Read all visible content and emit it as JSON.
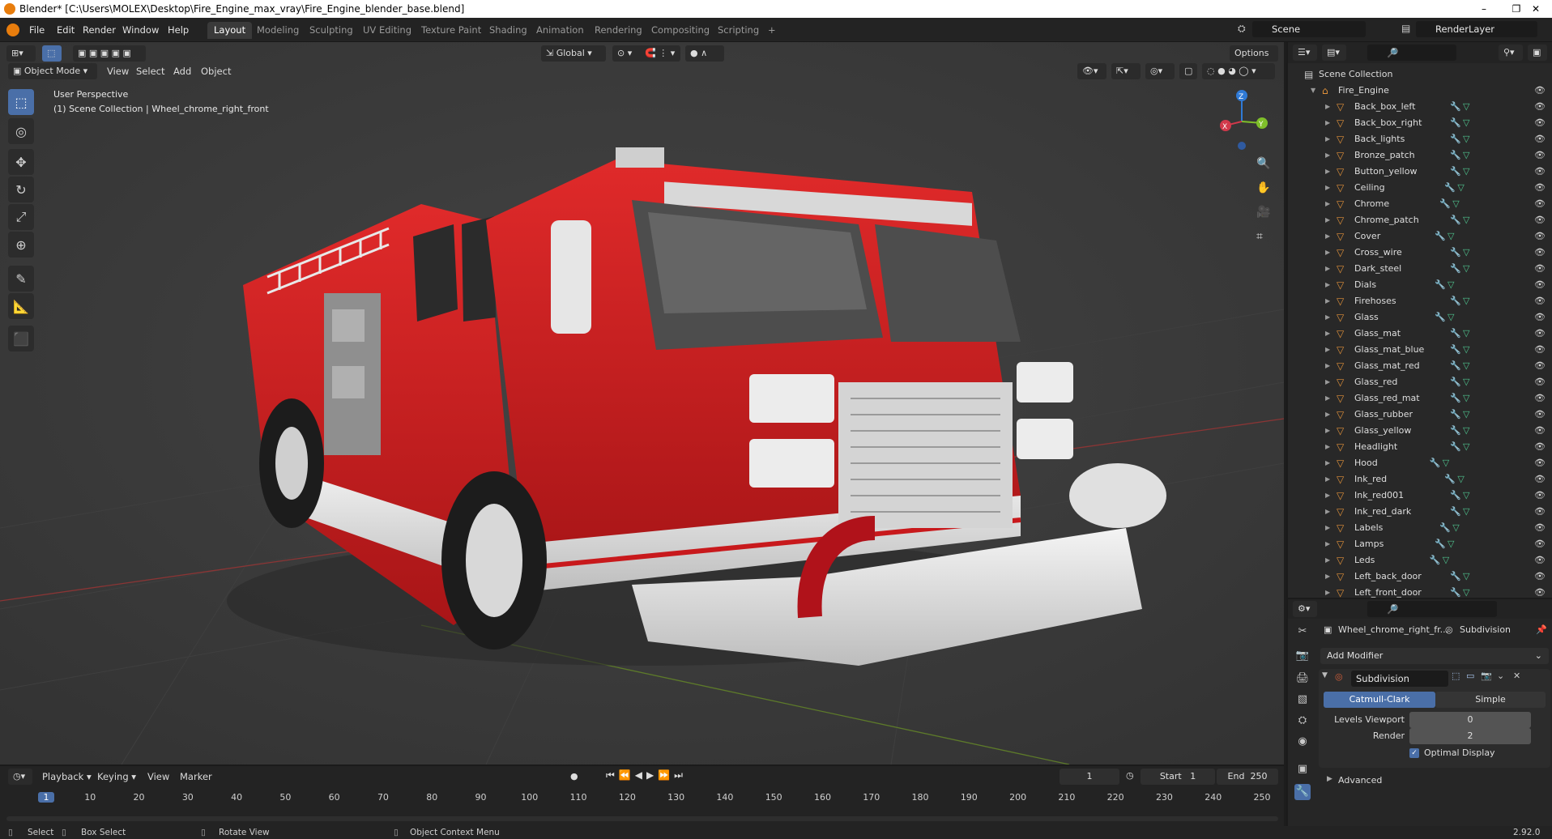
{
  "window": {
    "title": "Blender* [C:\\Users\\MOLEX\\Desktop\\Fire_Engine_max_vray\\Fire_Engine_blender_base.blend]",
    "minimize": "–",
    "maximize": "❐",
    "close": "✕"
  },
  "menu": [
    "File",
    "Edit",
    "Render",
    "Window",
    "Help"
  ],
  "workspaces": [
    "Layout",
    "Modeling",
    "Sculpting",
    "UV Editing",
    "Texture Paint",
    "Shading",
    "Animation",
    "Rendering",
    "Compositing",
    "Scripting"
  ],
  "add_workspace": "+",
  "scene": {
    "name": "Scene",
    "render_layer": "RenderLayer"
  },
  "viewport_header": {
    "mode": "Object Mode",
    "menus": [
      "View",
      "Select",
      "Add",
      "Object"
    ],
    "transform": "Global",
    "options": "Options"
  },
  "overlay_text": {
    "perspective": "User Perspective",
    "collection": "(1) Scene Collection | Wheel_chrome_right_front"
  },
  "gizmo": {
    "z": "Z",
    "y": "Y",
    "x": "X"
  },
  "outliner": {
    "root": "Scene Collection",
    "collection": "Fire_Engine",
    "items": [
      "Back_box_left",
      "Back_box_right",
      "Back_lights",
      "Bronze_patch",
      "Button_yellow",
      "Ceiling",
      "Chrome",
      "Chrome_patch",
      "Cover",
      "Cross_wire",
      "Dark_steel",
      "Dials",
      "Firehoses",
      "Glass",
      "Glass_mat",
      "Glass_mat_blue",
      "Glass_mat_red",
      "Glass_red",
      "Glass_red_mat",
      "Glass_rubber",
      "Glass_yellow",
      "Headlight",
      "Hood",
      "Ink_red",
      "Ink_red001",
      "Ink_red_dark",
      "Labels",
      "Lamps",
      "Leds",
      "Left_back_door",
      "Left_front_door"
    ]
  },
  "properties": {
    "object": "Wheel_chrome_right_fr...",
    "modifier_name_top": "Subdivision",
    "add_modifier": "Add Modifier",
    "modifier": {
      "name": "Subdivision",
      "mode_a": "Catmull-Clark",
      "mode_b": "Simple",
      "levels_viewport_label": "Levels Viewport",
      "levels_viewport": "0",
      "render_label": "Render",
      "render": "2",
      "optimal_display": "Optimal Display",
      "advanced": "Advanced"
    }
  },
  "timeline": {
    "menus": [
      "Playback",
      "Keying",
      "View",
      "Marker"
    ],
    "current_frame": "1",
    "start_label": "Start",
    "start": "1",
    "end_label": "End",
    "end": "250",
    "ticks": [
      "1",
      "10",
      "20",
      "30",
      "40",
      "50",
      "60",
      "70",
      "80",
      "90",
      "100",
      "110",
      "120",
      "130",
      "140",
      "150",
      "160",
      "170",
      "180",
      "190",
      "200",
      "210",
      "220",
      "230",
      "240",
      "250"
    ]
  },
  "status": {
    "select": "Select",
    "box_select": "Box Select",
    "rotate_view": "Rotate View",
    "context_menu": "Object Context Menu",
    "version": "2.92.0"
  },
  "colors": {
    "accent": "#4a6fa8",
    "truck_red": "#c8191c",
    "object_orange": "#e0913a",
    "modifier_blue": "#7aa6d8"
  }
}
